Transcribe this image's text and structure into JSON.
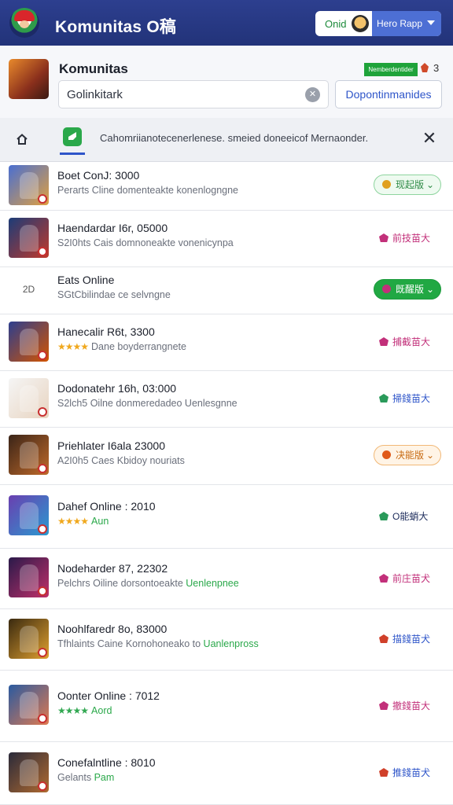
{
  "topbar": {
    "title": "Komunitas O稿",
    "user_name": "Onid",
    "user_tag": "Hero Rapp"
  },
  "community": {
    "title": "Komunitas",
    "members_badge": "Nemberdentider",
    "members_count": "3",
    "search_value": "Golinkitark",
    "search_placeholder": "Golinkitark",
    "join_label": "Dopontinmanides"
  },
  "tabbar": {
    "notice": "Cahomriianotecenerlenese. smeied doneeicof Mernaonder."
  },
  "colors": {
    "header_bg": "#223379",
    "accent_green": "#21a843",
    "accent_blue": "#2e55c9",
    "accent_orange": "#f0a81d"
  },
  "rows": [
    {
      "title": "Boet ConJ: 3000",
      "subtitle": "Perarts Cline domenteakte konenlogngne",
      "action": "现起版",
      "action_style": "pill-light-green"
    },
    {
      "title": "Haendardar I6r, 05000",
      "subtitle": "S2I0hts Cais domnoneakte vonenicynpa",
      "action": "前技苗大",
      "action_style": "link-magenta"
    },
    {
      "title": "Eats Online",
      "subtitle": "SGtCbilindae ce selvngne",
      "action": "既醒版",
      "action_style": "pill-solid-green",
      "thumb_text": "2D"
    },
    {
      "title": "Hanecalir R6t, 3300",
      "stars": "★★★★",
      "subtitle": "Dane boyderrangnete",
      "action": "捕截苗大",
      "action_style": "link-magenta"
    },
    {
      "title": "Dodonatehr 16h, 03:000",
      "subtitle": "S2lch5 Oilne donmeredadeo Uenlesgnne",
      "action": "掃錢苗大",
      "action_style": "link-blue"
    },
    {
      "title": "Priehlater I6ala 23000",
      "subtitle": "A2I0h5 Caes Kbidoy nouriats",
      "action": "决能版",
      "action_style": "pill-orange"
    },
    {
      "title": "Dahef Online :   2010",
      "stars": "★★★★",
      "subtitle": "Aun",
      "action": "O能蛸大",
      "action_style": "link-dark"
    },
    {
      "title": "Nodeharder 87, 22302",
      "subtitle": "Pelchrs Oiline dorsontoeakte Uenlenpnee",
      "subtitle_accent": "Uenlenpnee",
      "action": "前庄苗犬",
      "action_style": "link-magenta"
    },
    {
      "title": "Noohlfaredr 8o, 83000",
      "subtitle": "Tfhlaints Caine Kornohoneako to Uanlenpross",
      "subtitle_accent": "Uanlenpross",
      "action": "描錢苗犬",
      "action_style": "link-red"
    },
    {
      "title": "Oonter Online :   7012",
      "stars": "★★★★",
      "subtitle": "Aord",
      "action": "撤錢苗大",
      "action_style": "link-magenta"
    },
    {
      "title": "Conefalntline :   8010",
      "subtitle": "Gelants Pam",
      "subtitle_accent": "Pam",
      "action": "推錢苗犬",
      "action_style": "link-red"
    }
  ]
}
